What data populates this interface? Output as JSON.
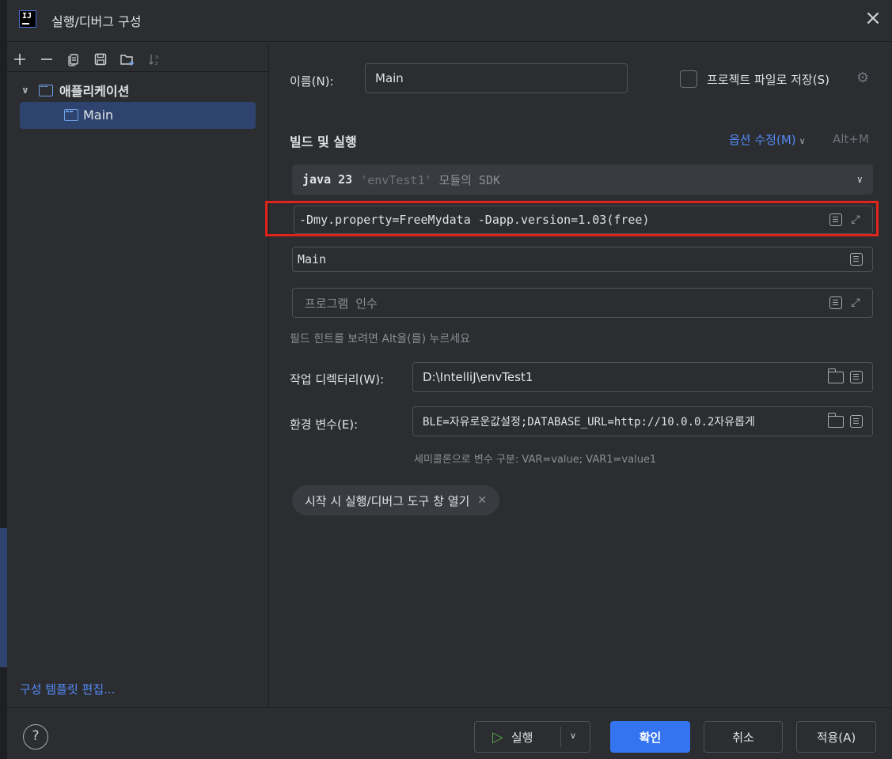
{
  "window": {
    "title": "실행/디버그 구성",
    "app_logo_text": "IJ"
  },
  "left_panel": {
    "tree_group": "애플리케이션",
    "tree_item": "Main",
    "edit_templates": "구성 템플릿 편집..."
  },
  "form": {
    "name_label": "이름(N):",
    "name_label_mnemonic": "N",
    "name_value": "Main",
    "save_to_project": "프로젝트 파일로 저장(S)",
    "save_to_project_checked": false,
    "section_title": "빌드 및 실행",
    "modify_options": "옵션 수정(M)",
    "modify_shortcut": "Alt+M",
    "sdk_java": "java 23",
    "sdk_module": "'envTest1'",
    "sdk_suffix": "모듈의 SDK",
    "vm_options": "-Dmy.property=FreeMydata -Dapp.version=1.03(free)",
    "main_class": "Main",
    "program_args_placeholder": "프로그램 인수",
    "field_hint": "필드 힌트를 보려면 Alt을(를) 누르세요",
    "working_dir_label": "작업 디렉터리(W):",
    "working_dir_value": "D:\\IntelliJ\\envTest1",
    "env_label": "환경 변수(E):",
    "env_value": "BLE=자유로운값설정;DATABASE_URL=http://10.0.0.2자유롭게",
    "env_hint": "세미콜론으로 변수 구분: VAR=value; VAR1=value1",
    "chip_label": "시작 시 실행/디버그 도구 창 열기"
  },
  "footer": {
    "help": "?",
    "run": "실행",
    "ok": "확인",
    "cancel": "취소",
    "apply": "적용(A)"
  },
  "colors": {
    "background": "#2b2d30",
    "accent_blue": "#3574f0",
    "link_blue": "#548af7",
    "selection": "#2e436e",
    "highlight_red": "#e0241b",
    "run_green": "#57a64a"
  },
  "icons": [
    "add-icon",
    "remove-icon",
    "copy-icon",
    "save-icon",
    "new-folder-icon",
    "sort-icon",
    "gear-icon",
    "document-icon",
    "expand-icon",
    "folder-icon",
    "play-icon",
    "help-icon",
    "close-icon"
  ]
}
